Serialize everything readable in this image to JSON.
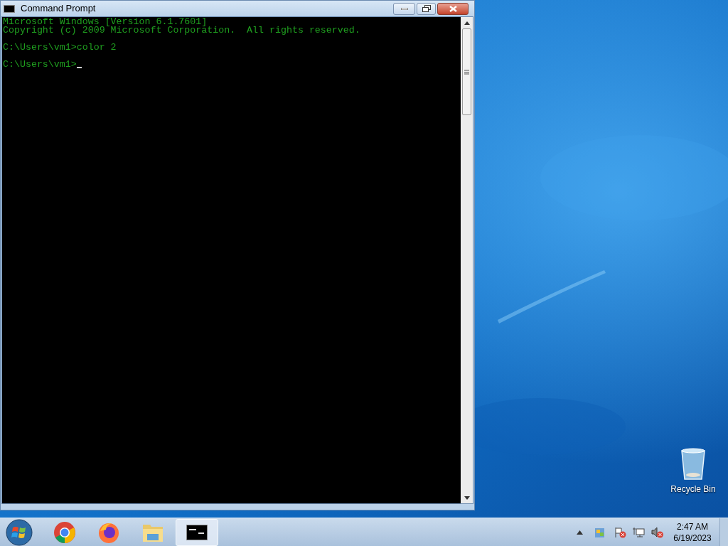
{
  "window": {
    "title": "Command Prompt"
  },
  "console": {
    "blocks": [
      [
        "Microsoft Windows [Version 6.1.7601]",
        "Copyright (c) 2009 Microsoft Corporation.  All rights reserved."
      ],
      [
        "C:\\Users\\vm1>color 2"
      ],
      [
        "C:\\Users\\vm1>"
      ]
    ]
  },
  "desktop_icons": [
    {
      "label": "Recycle Bin"
    }
  ],
  "taskbar": {
    "items": [
      {
        "kind": "chrome",
        "selected": false
      },
      {
        "kind": "firefox",
        "selected": false
      },
      {
        "kind": "explorer",
        "selected": false
      },
      {
        "kind": "cmd",
        "selected": true
      }
    ]
  },
  "clock": {
    "time": "2:47 AM",
    "date": "6/19/2023"
  }
}
